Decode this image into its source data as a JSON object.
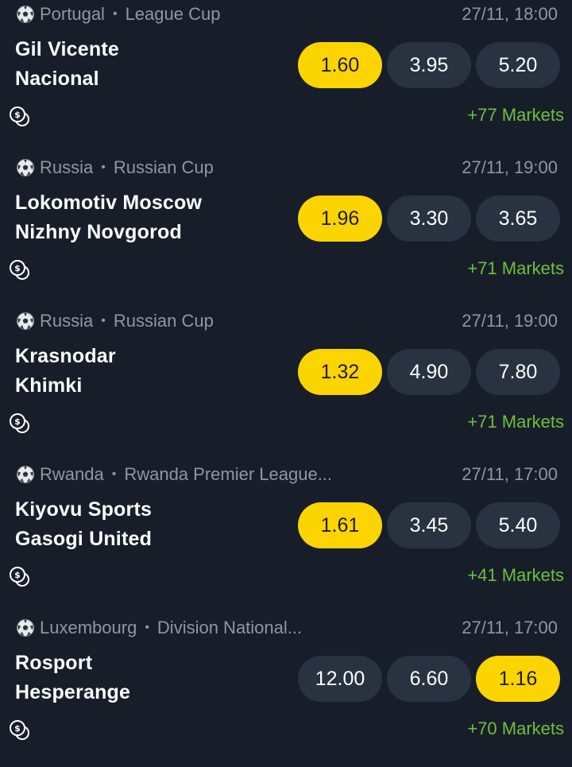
{
  "colors": {
    "background": "#171e29",
    "odd_button": "#283240",
    "odd_selected": "#fcd400",
    "markets_link": "#6fbf3c",
    "muted_text": "#8f97a3"
  },
  "icons": {
    "sport": "soccer-ball-icon",
    "cashout": "cashout-coin-icon"
  },
  "matches": [
    {
      "country": "Portugal",
      "league": "League Cup",
      "time": "27/11, 18:00",
      "home": "Gil Vicente",
      "away": "Nacional",
      "odds": [
        "1.60",
        "3.95",
        "5.20"
      ],
      "selected_index": 0,
      "markets": "+77 Markets"
    },
    {
      "country": "Russia",
      "league": "Russian Cup",
      "time": "27/11, 19:00",
      "home": "Lokomotiv Moscow",
      "away": "Nizhny Novgorod",
      "odds": [
        "1.96",
        "3.30",
        "3.65"
      ],
      "selected_index": 0,
      "markets": "+71 Markets"
    },
    {
      "country": "Russia",
      "league": "Russian Cup",
      "time": "27/11, 19:00",
      "home": "Krasnodar",
      "away": "Khimki",
      "odds": [
        "1.32",
        "4.90",
        "7.80"
      ],
      "selected_index": 0,
      "markets": "+71 Markets"
    },
    {
      "country": "Rwanda",
      "league": "Rwanda Premier League...",
      "time": "27/11, 17:00",
      "home": "Kiyovu Sports",
      "away": "Gasogi United",
      "odds": [
        "1.61",
        "3.45",
        "5.40"
      ],
      "selected_index": 0,
      "markets": "+41 Markets"
    },
    {
      "country": "Luxembourg",
      "league": "Division National...",
      "time": "27/11, 17:00",
      "home": "Rosport",
      "away": "Hesperange",
      "odds": [
        "12.00",
        "6.60",
        "1.16"
      ],
      "selected_index": 2,
      "markets": "+70 Markets"
    }
  ]
}
